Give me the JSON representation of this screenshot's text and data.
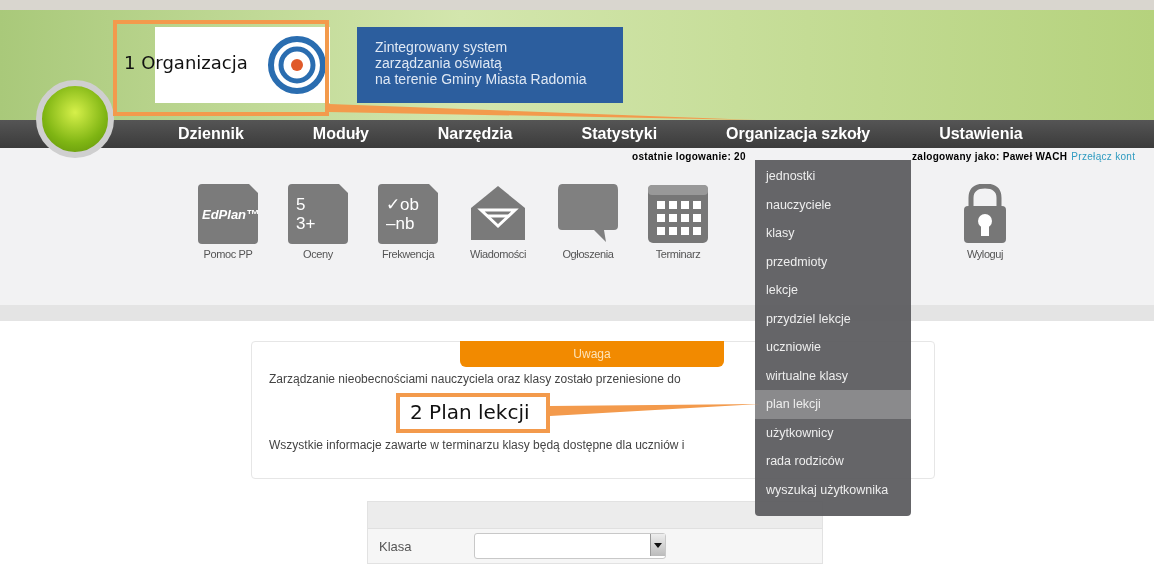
{
  "header": {
    "tagline": [
      "Zintegrowany system",
      "zarządzania oświatą",
      "na terenie Gminy Miasta Radomia"
    ]
  },
  "nav": [
    {
      "label": "Dziennik"
    },
    {
      "label": "Moduły"
    },
    {
      "label": "Narzędzia"
    },
    {
      "label": "Statystyki"
    },
    {
      "label": "Organizacja szkoły"
    },
    {
      "label": "Ustawienia"
    }
  ],
  "login": {
    "last_login": "ostatnie logowanie: 20",
    "user": "zalogowany jako: Paweł WACH",
    "switch_link": "Przełącz kont"
  },
  "tools": [
    {
      "kind": "doc",
      "glyph": [
        "EdPlan™"
      ],
      "label": "Pomoc PP"
    },
    {
      "kind": "doc",
      "glyph": [
        "5",
        "3+"
      ],
      "label": "Oceny"
    },
    {
      "kind": "doc",
      "glyph": [
        "✓ob",
        "–nb"
      ],
      "label": "Frekwencja"
    },
    {
      "kind": "mail",
      "label": "Wiadomości"
    },
    {
      "kind": "chat",
      "label": "Ogłoszenia"
    },
    {
      "kind": "calendar",
      "label": "Terminarz"
    },
    {
      "kind": "lock",
      "label": "Wyloguj"
    }
  ],
  "menu": [
    {
      "label": "jednostki",
      "selected": false
    },
    {
      "label": "nauczyciele",
      "selected": false
    },
    {
      "label": "klasy",
      "selected": false
    },
    {
      "label": "przedmioty",
      "selected": false
    },
    {
      "label": "lekcje",
      "selected": false
    },
    {
      "label": "przydziel lekcje",
      "selected": false
    },
    {
      "label": "uczniowie",
      "selected": false
    },
    {
      "label": "wirtualne klasy",
      "selected": false
    },
    {
      "label": "plan lekcji",
      "selected": true
    },
    {
      "label": "użytkownicy",
      "selected": false
    },
    {
      "label": "rada rodziców",
      "selected": false
    },
    {
      "label": "wyszukaj użytkownika",
      "selected": false
    }
  ],
  "notice": {
    "title": "Uwaga",
    "lines": [
      "Zarządzanie nieobecnościami nauczyciela oraz klasy zostało przeniesione do",
      "Wszystkie informacje zawarte w terminarzu klasy będą dostępne dla uczniów i"
    ]
  },
  "form": {
    "fields": [
      {
        "label": "Klasa"
      }
    ]
  },
  "annotations": [
    {
      "label": "1 Organizacja"
    },
    {
      "label": "2 Plan lekcji"
    }
  ]
}
